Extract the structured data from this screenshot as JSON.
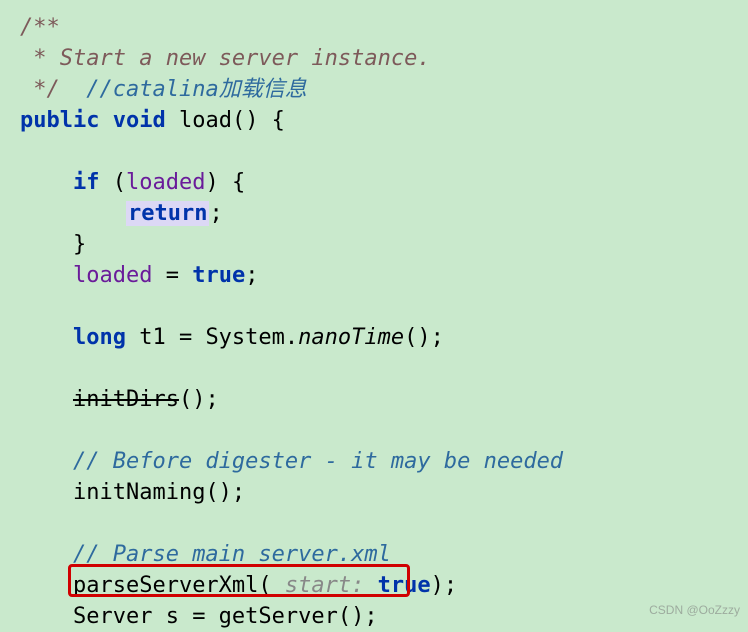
{
  "code": {
    "doc_open": "/**",
    "doc_line": " * Start a new server instance.",
    "doc_close": " */",
    "cn_comment": "//catalina加载信息",
    "kw_public": "public",
    "kw_void": "void",
    "fn_load": "load() {",
    "kw_if": "if",
    "field_loaded": "loaded",
    "paren_txt": ") {",
    "kw_return": "return",
    "semicolon": ";",
    "brace_close": "}",
    "assign_eq": " = ",
    "kw_true": "true",
    "kw_long": "long",
    "t1_assign": " t1 = System.",
    "nanoTime": "nanoTime",
    "call_suffix": "();",
    "initDirs": "initDirs",
    "comment_before": "// Before digester - it may be needed",
    "initNaming": "initNaming();",
    "comment_parse": "// Parse main server.xml",
    "parseServerXml": "parseServerXml(",
    "hint_start": " start: ",
    "close_paren_semi": ");",
    "server_line": "Server s = getServer();"
  },
  "watermark": "CSDN @OoZzzy"
}
